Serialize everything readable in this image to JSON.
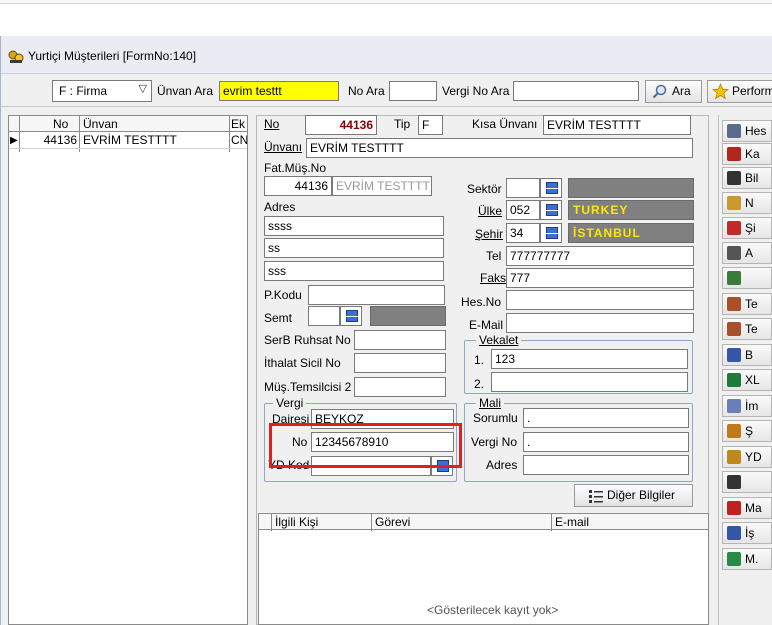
{
  "window": {
    "title": "Yurtiçi Müşterileri [FormNo:140]"
  },
  "toolbar": {
    "firma_combo": "F : Firma",
    "unvan_ara_label": "Ünvan Ara",
    "unvan_ara_value": "evrim testtt",
    "no_ara_label": "No Ara",
    "no_ara_value": "",
    "vergi_no_ara_label": "Vergi No Ara",
    "vergi_no_ara_value": "",
    "ara_button": "Ara",
    "perform_button": "Perform"
  },
  "customer_grid": {
    "columns": [
      "No",
      "Ünvan",
      "Ek"
    ],
    "rows": [
      {
        "no": "44136",
        "unvan": "EVRİM TESTTTT",
        "ek": "CN"
      }
    ]
  },
  "form": {
    "no_label": "No",
    "no_value": "44136",
    "tip_label": "Tip",
    "tip_value": "F",
    "kisa_unvan_label": "Kısa Ünvanı",
    "kisa_unvan_value": "EVRİM TESTTTT",
    "unvan_label": "Ünvanı",
    "unvan_value": "EVRİM TESTTTT",
    "fat_mus_no_label": "Fat.Müş.No",
    "fat_mus_no_value": "44136",
    "fat_mus_name_value": "EVRİM TESTTTT",
    "adres_label": "Adres",
    "adres_lines": [
      "ssss",
      "ss",
      "sss"
    ],
    "pkodu_label": "P.Kodu",
    "pkodu_value": "",
    "semt_label": "Semt",
    "serb_ruhsat_label": "SerB Ruhsat No",
    "ithalat_sicil_label": "İthalat Sicil No",
    "mus_temsilcisi_label": "Müş.Temsilcisi 2",
    "sektor_label": "Sektör",
    "ulke_label": "Ülke",
    "ulke_code": "052",
    "ulke_name": "TURKEY",
    "sehir_label": "Şehir",
    "sehir_code": "34",
    "sehir_name": "İSTANBUL",
    "tel_label": "Tel",
    "tel_value": "777777777",
    "faks_label": "Faks",
    "faks_value": "777",
    "hes_no_label": "Hes.No",
    "email_label": "E-Mail",
    "vekalet_title": "Vekalet",
    "vekalet_1_label": "1.",
    "vekalet_1_value": "123",
    "vekalet_2_label": "2.",
    "vekalet_2_value": "",
    "vergi_title": "Vergi",
    "vergi_dairesi_label": "Dairesi",
    "vergi_dairesi_value": "BEYKOZ",
    "vergi_no_label": "No",
    "vergi_no_value": "12345678910",
    "yd_kod_label": "YD Kod",
    "mali_title": "Mali",
    "sorumlu_label": "Sorumlu",
    "sorumlu_value": ".",
    "mali_vergi_no_label": "Vergi No",
    "mali_vergi_no_value": ".",
    "mali_adres_label": "Adres",
    "diger_bilgiler_button": "Diğer Bilgiler"
  },
  "contacts_grid": {
    "columns": [
      "İlgili Kişi",
      "Görevi",
      "E-mail"
    ],
    "empty_text": "<Gösterilecek kayıt yok>"
  },
  "side_buttons": [
    {
      "label": "Hes",
      "icon": "link-icon",
      "color": "#5b6b8a"
    },
    {
      "label": "Ka",
      "icon": "eraser-icon",
      "color": "#b3261e"
    },
    {
      "label": "Bil",
      "icon": "document-icon",
      "color": "#333333"
    },
    {
      "label": "N",
      "icon": "notes-icon",
      "color": "#c79a2b"
    },
    {
      "label": "Şi",
      "icon": "key-icon",
      "color": "#c02a2a"
    },
    {
      "label": "A",
      "icon": "search-doc-icon",
      "color": "#555555"
    },
    {
      "label": "",
      "icon": "globe-icon",
      "color": "#3a7a3a"
    },
    {
      "label": "Te",
      "icon": "people-icon",
      "color": "#a8502a"
    },
    {
      "label": "Te",
      "icon": "people-icon",
      "color": "#a8502a"
    },
    {
      "label": "B",
      "icon": "users-icon",
      "color": "#3556a8"
    },
    {
      "label": "XL",
      "icon": "excel-icon",
      "color": "#1f7a3a"
    },
    {
      "label": "İm",
      "icon": "group-icon",
      "color": "#6a7fb8"
    },
    {
      "label": "Ş",
      "icon": "user-arrow-icon",
      "color": "#c07a1a"
    },
    {
      "label": "YD",
      "icon": "foreign-icon",
      "color": "#c08a1a"
    },
    {
      "label": "",
      "icon": "print-icon",
      "color": "#333333"
    },
    {
      "label": "Ma",
      "icon": "warning-icon",
      "color": "#c0201f"
    },
    {
      "label": "İş",
      "icon": "edit-icon",
      "color": "#3556a8"
    },
    {
      "label": "M.",
      "icon": "arrow-icon",
      "color": "#2a8a4a"
    }
  ]
}
